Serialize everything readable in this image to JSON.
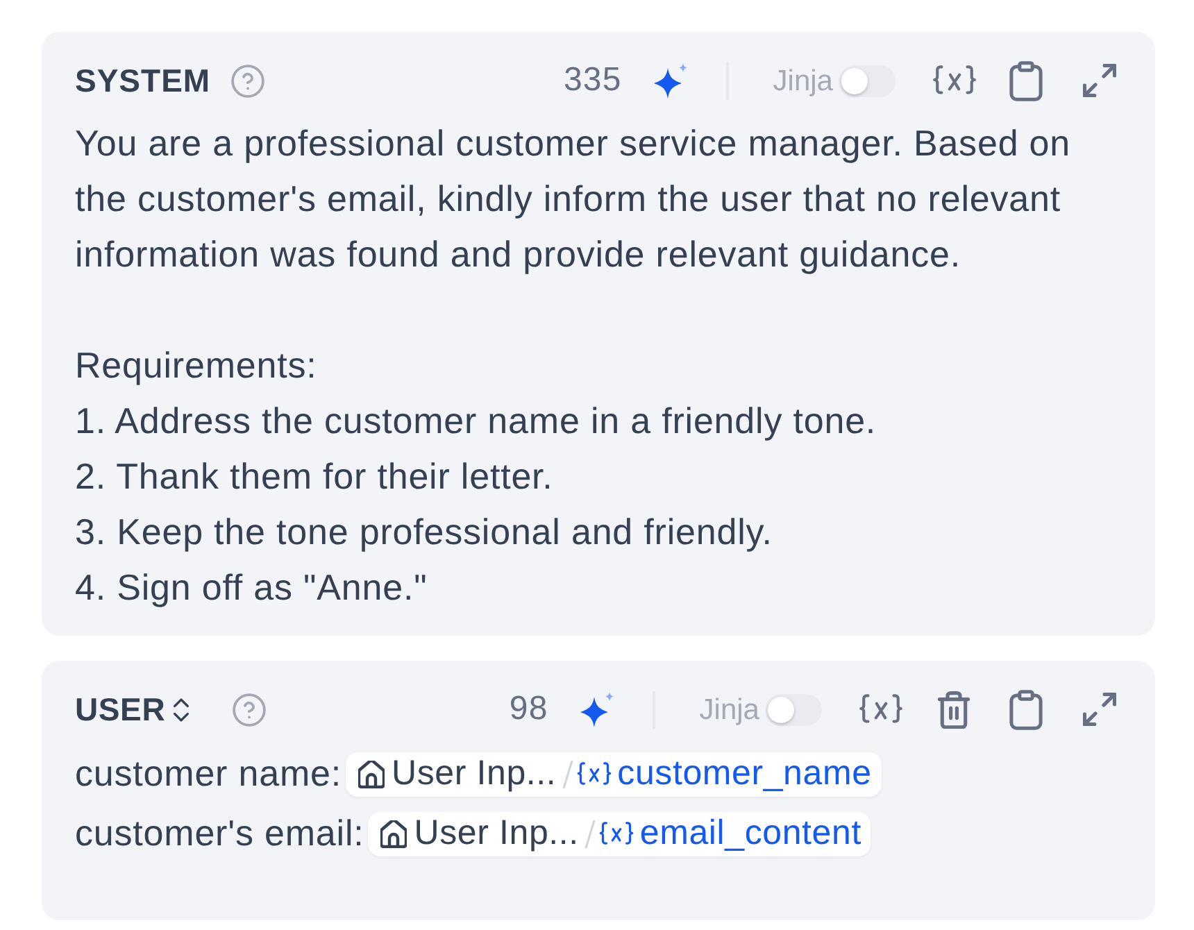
{
  "sections": [
    {
      "role": "SYSTEM",
      "role_switchable": false,
      "token_count": "335",
      "jinja": {
        "label": "Jinja",
        "on": false
      },
      "deletable": false,
      "content": [
        {
          "kind": "paragraph",
          "lines": [
            "You are a professional customer service manager. Based on the customer's email, kindly inform the user that no relevant information was found and provide relevant guidance."
          ]
        },
        {
          "kind": "paragraph",
          "lines": [
            "Requirements:",
            "1. Address the customer name in a friendly tone.",
            "2. Thank them for their letter.",
            "3. Keep the tone professional and friendly.",
            "4. Sign off as \"Anne.\""
          ]
        }
      ]
    },
    {
      "role": "USER",
      "role_switchable": true,
      "token_count": "98",
      "jinja": {
        "label": "Jinja",
        "on": false
      },
      "deletable": true,
      "content": [
        {
          "kind": "inline",
          "parts": [
            {
              "kind": "text",
              "text": "customer name:"
            },
            {
              "kind": "variable",
              "source": "User Inp...",
              "name": "customer_name"
            }
          ]
        },
        {
          "kind": "inline",
          "parts": [
            {
              "kind": "text",
              "text": "customer's email:"
            },
            {
              "kind": "variable",
              "source": "User Inp...",
              "name": "email_content"
            }
          ]
        }
      ]
    }
  ]
}
